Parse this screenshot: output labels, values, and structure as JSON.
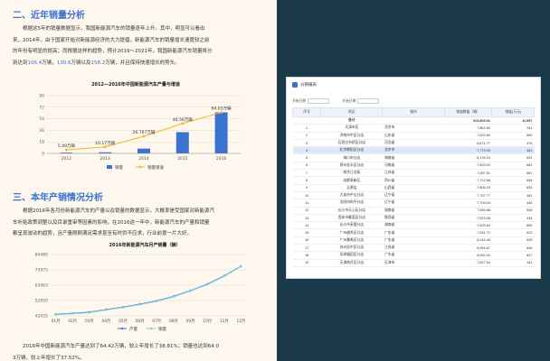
{
  "doc": {
    "section2_title": "二、近年销量分析",
    "para1": [
      "根据这5年的销量数据显示，我国新能源汽车的销量逐年上升。其中，明显可以看出",
      "来，2014年，由于国家开始对新能源经济的大力提倡，新能源汽车的销量增长速度较之前",
      "的年份有明显的提高；而根据这样的趋势，预计2019～2021年，我国新能源汽车销量将分"
    ],
    "para1_last": {
      "prefix": "别达到",
      "v1": "106.4",
      "mid1": "万辆，",
      "v2": "130.6",
      "mid2": "万辆以及",
      "v3": "158.2",
      "suffix": "万辆，并且保持快速增长的势头。"
    },
    "section3_title": "三、本年产销情况分析",
    "para2": [
      "根据2016年各月份新能源汽车的产量以及销量的数据显示，大概率是受国家对新能源汽",
      "车补贴政策调整以及目录重审等因素的影响，在2016这一年中，新能源汽车的产量和销量",
      "都呈现波动的趋势，且产量刚刚满足需求甚至有时供不应求，行业前景一片大好。"
    ],
    "para3": [
      "2016年中国新能源汽车产量达到了64.42万辆，较上年增长了38.81%；销量也达到64.0",
      "3万辆，较上年增长了37.52%。"
    ]
  },
  "chart_data": [
    {
      "type": "bar",
      "title": "2012—2016年中国新能源汽车产量与增速",
      "categories": [
        "2012",
        "2013",
        "2014",
        "2015",
        "2016"
      ],
      "series": [
        {
          "name": "销量",
          "values": [
            1.28,
            1.76,
            7.48,
            33.11,
            64.03
          ],
          "color": "#3a72d0"
        },
        {
          "name": "销量增速",
          "values": [
            5.49,
            10.17,
            26.767,
            46.56,
            64.03
          ],
          "color": "#f5b325"
        }
      ],
      "data_labels": [
        "5.49万辆",
        "10.17万辆",
        "26.767万辆",
        "46.56万辆",
        "64.03万辆"
      ],
      "yticks": [
        0,
        18,
        36,
        54,
        72,
        90
      ],
      "ylim": [
        0,
        90
      ],
      "legend": "bottom"
    },
    {
      "type": "line",
      "title": "2016年新能源汽车月产销量（辆）",
      "categories": [
        "01月",
        "02月",
        "03月",
        "04月",
        "05月",
        "06月",
        "07月",
        "08月",
        "09月",
        "10月",
        "11月",
        "12月"
      ],
      "series": [
        {
          "name": "产量",
          "values": [
            43500,
            44200,
            45000,
            46800,
            48500,
            50500,
            52700,
            55800,
            59800,
            64200,
            69800,
            76500
          ],
          "color": "#3a72d0"
        },
        {
          "name": "销量",
          "values": [
            43200,
            43900,
            44700,
            46500,
            48200,
            50200,
            52400,
            55500,
            59500,
            63900,
            69500,
            76300
          ],
          "color": "#7fd3e0"
        }
      ],
      "yticks": [
        42435,
        52950,
        63463,
        73975,
        84480
      ],
      "ylim": [
        42435,
        84480
      ],
      "legend": "bottom"
    }
  ],
  "app": {
    "title": "分销报表",
    "filters": [
      {
        "label": "开始日期"
      },
      {
        "label": "开始日期"
      }
    ],
    "columns": [
      "序号",
      "地区",
      "城市",
      "销量数量（辆）",
      "销量(万元)"
    ],
    "total_label": "合计",
    "total_qty": "313,503.01",
    "total_amount": "11,597",
    "rows": [
      [
        "1",
        "天津市区",
        "北京市",
        "7,862.65",
        "511"
      ],
      [
        "2",
        "济南市中区分店",
        "山东省",
        "7,629.84",
        "689"
      ],
      [
        "3",
        "石家庄市桥区分店",
        "河北省",
        "6,871.77",
        "476"
      ],
      [
        "4",
        "北京朝阳区分店",
        "北京市",
        "7,779.99",
        "481"
      ],
      [
        "5",
        "海口市分店",
        "海南省",
        "8,176.15",
        "591"
      ],
      [
        "6",
        "郑州金水区分店",
        "河南省",
        "7,829.00",
        "681"
      ],
      [
        "7",
        "南京江北街",
        "江苏省",
        "7,287.51",
        "687"
      ],
      [
        "8",
        "成都高新区",
        "四川省",
        "7,712.58",
        "654"
      ],
      [
        "9",
        "太原店",
        "山西省",
        "7,806.15",
        "634"
      ],
      [
        "10",
        "大连市中山分店",
        "辽宁省",
        "7,797.77",
        "481"
      ],
      [
        "11",
        "沈阳市和平分店",
        "辽宁省",
        "7,709.09",
        "446"
      ],
      [
        "12",
        "长沙市天心区分店",
        "湖南省",
        "7,955.88",
        "548"
      ],
      [
        "13",
        "西安市雁塔区分店",
        "陕西省",
        "7,523.08",
        "434"
      ],
      [
        "14",
        "长沙市芙蓉分店",
        "湖南省",
        "7,625.64",
        "589"
      ],
      [
        "15",
        "广州越秀区分店",
        "广东省",
        "7,931.71",
        "623"
      ],
      [
        "16",
        "广州番禺区分店",
        "广东省",
        "8,244.48",
        "628"
      ],
      [
        "17",
        "苏州吴中区分店",
        "江苏省",
        "8,054.87",
        "628"
      ],
      [
        "18",
        "深圳福田区分店",
        "广东省",
        "8,092.42",
        "627"
      ],
      [
        "19",
        "天津南开区分店",
        "天津市",
        "7,627.54",
        "611"
      ]
    ]
  }
}
